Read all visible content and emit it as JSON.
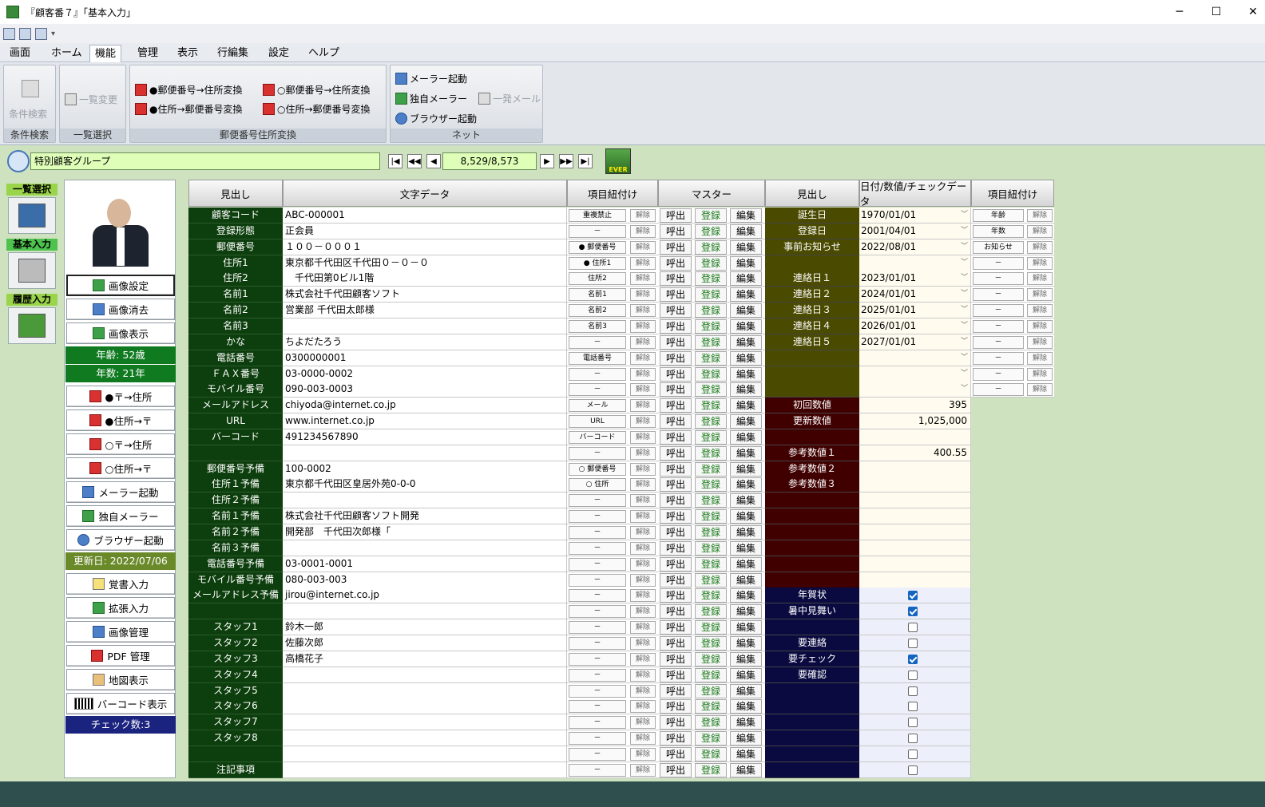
{
  "window": {
    "title": "『顧客番７』「基本入力」",
    "minimize": "─",
    "maximize": "☐",
    "close": "✕"
  },
  "menu": [
    "画面",
    "ホーム",
    "機能",
    "管理",
    "表示",
    "行編集",
    "設定",
    "ヘルプ"
  ],
  "ribbon": {
    "g1": {
      "btn": "条件検索",
      "label": "条件検索"
    },
    "g2": {
      "btn": "一覧変更",
      "label": "一覧選択"
    },
    "g3": {
      "b1": "●郵便番号→住所変換",
      "b2": "●住所→郵便番号変換",
      "b3": "○郵便番号→住所変換",
      "b4": "○住所→郵便番号変換",
      "label": "郵便番号住所変換"
    },
    "g4": {
      "b1": "メーラー起動",
      "b2": "独自メーラー",
      "b3": "一発メール",
      "b4": "ブラウザー起動",
      "label": "ネット"
    }
  },
  "nav": {
    "group": "特別顧客グループ",
    "counter": "8,529/8,573",
    "ever": "EVER"
  },
  "leftnav": [
    "一覧選択",
    "基本入力",
    "履歴入力"
  ],
  "sidebar": {
    "img_set": "画像設定",
    "img_del": "画像消去",
    "img_show": "画像表示",
    "age": "年齢: 52歳",
    "years": "年数: 21年",
    "b1": "●〒→住所",
    "b2": "●住所→〒",
    "b3": "○〒→住所",
    "b4": "○住所→〒",
    "b5": "メーラー起動",
    "b6": "独自メーラー",
    "b7": "ブラウザー起動",
    "updated": "更新日: 2022/07/06",
    "b8": "覚書入力",
    "b9": "拡張入力",
    "b10": "画像管理",
    "b11": "PDF 管理",
    "b12": "地図表示",
    "b13": "バーコード表示",
    "checks": "チェック数:3"
  },
  "headers": {
    "h1": "見出し",
    "h2": "文字データ",
    "h3": "項目紐付け",
    "h4": "マスター",
    "h5": "見出し",
    "h6": "日付/数値/チェックデータ",
    "h7": "項目紐付け"
  },
  "btn": {
    "release": "解除",
    "call": "呼出",
    "register": "登録",
    "edit": "編集"
  },
  "rows": [
    {
      "label": "顧客コード",
      "text": "ABC-000001",
      "link": "重複禁止"
    },
    {
      "label": "登録形態",
      "text": "正会員",
      "link": "－"
    },
    {
      "label": "郵便番号",
      "text": "１００－０００１",
      "link": "● 郵便番号"
    },
    {
      "label": "住所1",
      "text": "東京都千代田区千代田０－０－０",
      "link": "● 住所1"
    },
    {
      "label": "住所2",
      "text": "　千代田第0ビル1階",
      "link": "住所2"
    },
    {
      "label": "名前1",
      "text": "株式会社千代田顧客ソフト",
      "link": "名前1"
    },
    {
      "label": "名前2",
      "text": "営業部 千代田太郎様",
      "link": "名前2"
    },
    {
      "label": "名前3",
      "text": "",
      "link": "名前3"
    },
    {
      "label": "かな",
      "text": "ちよだたろう",
      "link": "－"
    },
    {
      "label": "電話番号",
      "text": "0300000001",
      "link": "電話番号"
    },
    {
      "label": "ＦＡＸ番号",
      "text": "03-0000-0002",
      "link": "－"
    },
    {
      "label": "モバイル番号",
      "text": "090-003-0003",
      "link": "－"
    },
    {
      "label": "メールアドレス",
      "text": "chiyoda@internet.co.jp",
      "link": "メール"
    },
    {
      "label": "URL",
      "text": "www.internet.co.jp",
      "link": "URL"
    },
    {
      "label": "バーコード",
      "text": "491234567890",
      "link": "バーコード"
    },
    {
      "label": "",
      "text": "",
      "link": "－"
    },
    {
      "label": "郵便番号予備",
      "text": "100-0002",
      "link": "○ 郵便番号"
    },
    {
      "label": "住所１予備",
      "text": "東京都千代田区皇居外苑0-0-0",
      "link": "○ 住所"
    },
    {
      "label": "住所２予備",
      "text": "",
      "link": "－"
    },
    {
      "label": "名前１予備",
      "text": "株式会社千代田顧客ソフト開発",
      "link": "－"
    },
    {
      "label": "名前２予備",
      "text": "開発部　千代田次郎様「",
      "link": "－"
    },
    {
      "label": "名前３予備",
      "text": "",
      "link": "－"
    },
    {
      "label": "電話番号予備",
      "text": "03-0001-0001",
      "link": "－"
    },
    {
      "label": "モバイル番号予備",
      "text": "080-003-003",
      "link": "－"
    },
    {
      "label": "メールアドレス予備",
      "text": "jirou@internet.co.jp",
      "link": "－"
    },
    {
      "label": "",
      "text": "",
      "link": "－"
    },
    {
      "label": "スタッフ1",
      "text": "鈴木一郎",
      "link": "－"
    },
    {
      "label": "スタッフ2",
      "text": "佐藤次郎",
      "link": "－"
    },
    {
      "label": "スタッフ3",
      "text": "高橋花子",
      "link": "－"
    },
    {
      "label": "スタッフ4",
      "text": "",
      "link": "－"
    },
    {
      "label": "スタッフ5",
      "text": "",
      "link": "－"
    },
    {
      "label": "スタッフ6",
      "text": "",
      "link": "－"
    },
    {
      "label": "スタッフ7",
      "text": "",
      "link": "－"
    },
    {
      "label": "スタッフ8",
      "text": "",
      "link": "－"
    },
    {
      "label": "",
      "text": "",
      "link": "－"
    },
    {
      "label": "注記事項",
      "text": "",
      "link": "－"
    }
  ],
  "right_dates": [
    {
      "label": "誕生日",
      "value": "1970/01/01",
      "link": "年齢"
    },
    {
      "label": "登録日",
      "value": "2001/04/01",
      "link": "年数"
    },
    {
      "label": "事前お知らせ",
      "value": "2022/08/01",
      "link": "お知らせ"
    },
    {
      "label": "",
      "value": "",
      "link": "－"
    },
    {
      "label": "連絡日１",
      "value": "2023/01/01",
      "link": "－"
    },
    {
      "label": "連絡日２",
      "value": "2024/01/01",
      "link": "－"
    },
    {
      "label": "連絡日３",
      "value": "2025/01/01",
      "link": "－"
    },
    {
      "label": "連絡日４",
      "value": "2026/01/01",
      "link": "－"
    },
    {
      "label": "連絡日５",
      "value": "2027/01/01",
      "link": "－"
    },
    {
      "label": "",
      "value": "",
      "link": "－"
    },
    {
      "label": "",
      "value": "",
      "link": "－"
    },
    {
      "label": "",
      "value": "",
      "link": "－"
    }
  ],
  "right_nums": [
    {
      "label": "初回数値",
      "value": "395"
    },
    {
      "label": "更新数値",
      "value": "1,025,000"
    },
    {
      "label": "",
      "value": ""
    },
    {
      "label": "参考数値１",
      "value": "400.55"
    },
    {
      "label": "参考数値２",
      "value": ""
    },
    {
      "label": "参考数値３",
      "value": ""
    },
    {
      "label": "",
      "value": ""
    },
    {
      "label": "",
      "value": ""
    },
    {
      "label": "",
      "value": ""
    },
    {
      "label": "",
      "value": ""
    },
    {
      "label": "",
      "value": ""
    },
    {
      "label": "",
      "value": ""
    }
  ],
  "right_checks": [
    {
      "label": "年賀状",
      "checked": true
    },
    {
      "label": "暑中見舞い",
      "checked": true
    },
    {
      "label": "",
      "checked": false
    },
    {
      "label": "要連絡",
      "checked": false
    },
    {
      "label": "要チェック",
      "checked": true
    },
    {
      "label": "要確認",
      "checked": false
    },
    {
      "label": "",
      "checked": false
    },
    {
      "label": "",
      "checked": false
    },
    {
      "label": "",
      "checked": false
    },
    {
      "label": "",
      "checked": false
    },
    {
      "label": "",
      "checked": false
    },
    {
      "label": "",
      "checked": false
    }
  ],
  "colors": {
    "label_green": "#0d3e0d",
    "date_olive": "#4a4a00",
    "num_maroon": "#400000",
    "check_navy": "#0a0a40",
    "age_green": "#0f7a20",
    "updated_olive": "#6a8a2a",
    "checks_navy": "#1a237e"
  }
}
